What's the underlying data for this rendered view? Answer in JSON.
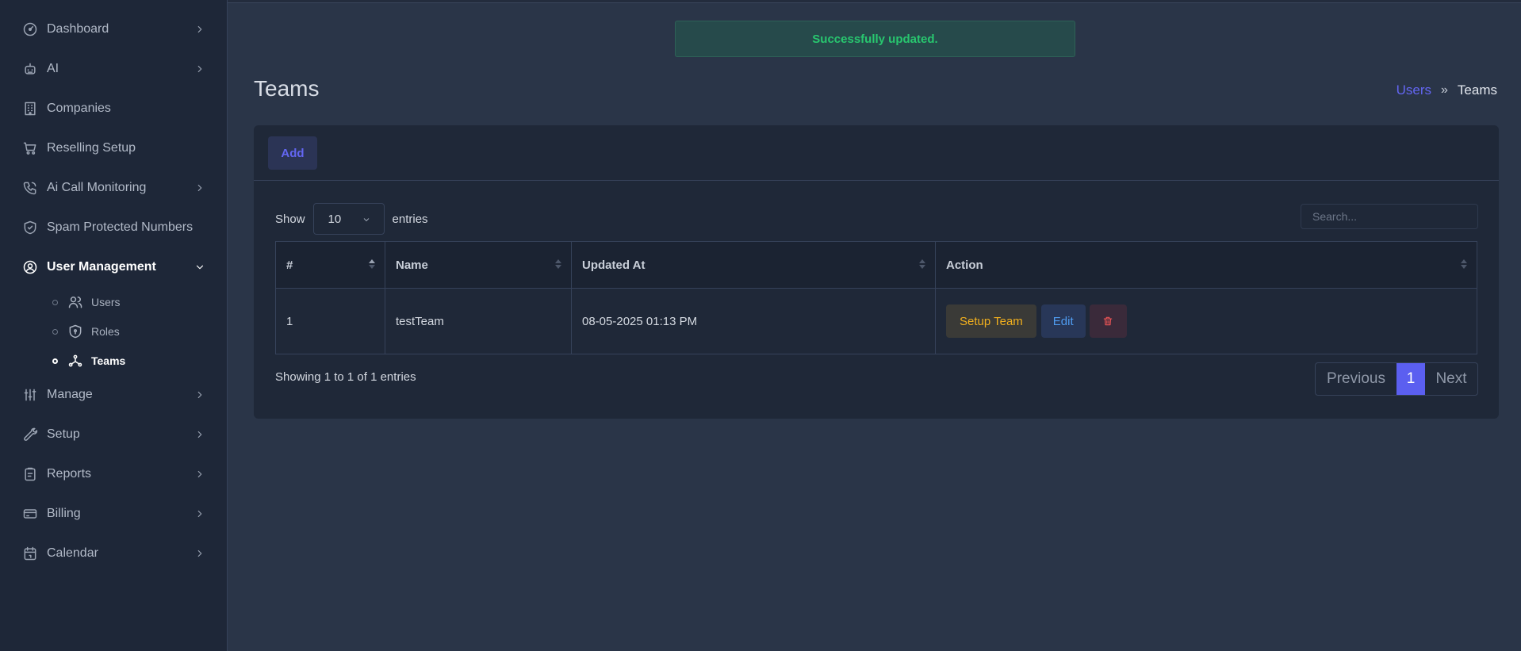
{
  "sidebar": {
    "items": [
      {
        "label": "Dashboard",
        "icon": "gauge-icon",
        "has_chevron": true
      },
      {
        "label": "AI",
        "icon": "robot-icon",
        "has_chevron": true
      },
      {
        "label": "Companies",
        "icon": "building-icon",
        "has_chevron": false
      },
      {
        "label": "Reselling Setup",
        "icon": "cart-icon",
        "has_chevron": false
      },
      {
        "label": "Ai Call Monitoring",
        "icon": "phone-icon",
        "has_chevron": true
      },
      {
        "label": "Spam Protected Numbers",
        "icon": "shield-check-icon",
        "has_chevron": false
      },
      {
        "label": "User Management",
        "icon": "user-circle-icon",
        "has_chevron": true,
        "expanded": true
      },
      {
        "label": "Manage",
        "icon": "sliders-icon",
        "has_chevron": true
      },
      {
        "label": "Setup",
        "icon": "wrench-icon",
        "has_chevron": true
      },
      {
        "label": "Reports",
        "icon": "clipboard-icon",
        "has_chevron": true
      },
      {
        "label": "Billing",
        "icon": "credit-card-icon",
        "has_chevron": true
      },
      {
        "label": "Calendar",
        "icon": "calendar-icon",
        "has_chevron": true
      }
    ],
    "sub_items": [
      {
        "label": "Users",
        "icon": "users-icon"
      },
      {
        "label": "Roles",
        "icon": "shield-icon"
      },
      {
        "label": "Teams",
        "icon": "team-nodes-icon",
        "active": true
      }
    ]
  },
  "alert": {
    "text": "Successfully updated.",
    "color": "#28c76f"
  },
  "page": {
    "title": "Teams"
  },
  "breadcrumb": {
    "parent": "Users",
    "separator": "»",
    "current": "Teams"
  },
  "toolbar": {
    "add_label": "Add"
  },
  "table_controls": {
    "show_label": "Show",
    "page_length": "10",
    "entries_label": "entries",
    "search_placeholder": "Search..."
  },
  "table": {
    "columns": [
      "#",
      "Name",
      "Updated At",
      "Action"
    ],
    "rows": [
      {
        "index": "1",
        "name": "testTeam",
        "updated_at": "08-05-2025 01:13 PM"
      }
    ],
    "actions": {
      "setup_label": "Setup Team",
      "edit_label": "Edit",
      "delete_icon": "trash-icon"
    }
  },
  "footer": {
    "info": "Showing 1 to 1 of 1 entries",
    "previous_label": "Previous",
    "current_page": "1",
    "next_label": "Next"
  },
  "colors": {
    "accent": "#6366f1",
    "success": "#28c76f",
    "warning": "#f2b01e",
    "danger": "#ea5455",
    "info": "#4f9cf0"
  }
}
